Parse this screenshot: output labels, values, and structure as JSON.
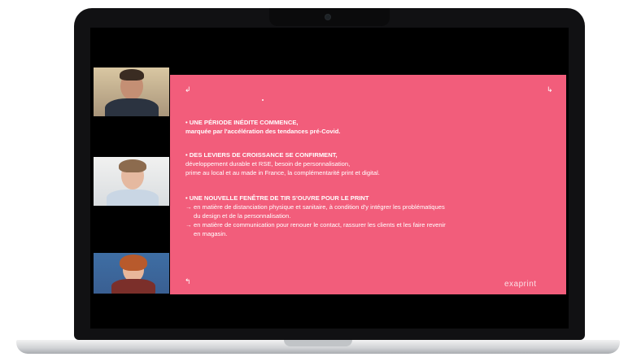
{
  "colors": {
    "slide_background": "#f25d7b",
    "laptop_body": "#111113",
    "screen": "#000000",
    "text": "#ffffff"
  },
  "participants": [
    {
      "icon": "participant-video-man"
    },
    {
      "icon": "participant-video-woman"
    },
    {
      "icon": "participant-video-woman-red-hair"
    }
  ],
  "slide": {
    "corner_marks": {
      "top_left": "↲",
      "top_right": "↳",
      "bottom_left": "↰"
    },
    "logo_text": "exaprint",
    "section1": {
      "heading": "• UNE PÉRIODE INÉDITE COMMENCE,",
      "line": "marquée par l'accélération des tendances pré-Covid."
    },
    "section2": {
      "heading": "• DES LEVIERS DE CROISSANCE SE CONFIRMENT,",
      "line1": "développement durable et RSE, besoin de personnalisation,",
      "line2": "prime au local et au made in France, la complémentarité print et digital."
    },
    "section3": {
      "heading": "• UNE NOUVELLE FENÊTRE DE TIR S'OUVRE POUR LE PRINT",
      "arrow": "→",
      "item1_line1": "en matière de distanciation physique et sanitaire, à condition d'y intégrer les problématiques",
      "item1_line2": "du design et de la personnalisation.",
      "item2_line1": "en matière de communication pour renouer le contact, rassurer les clients et les faire revenir",
      "item2_line2": "en magasin."
    }
  }
}
